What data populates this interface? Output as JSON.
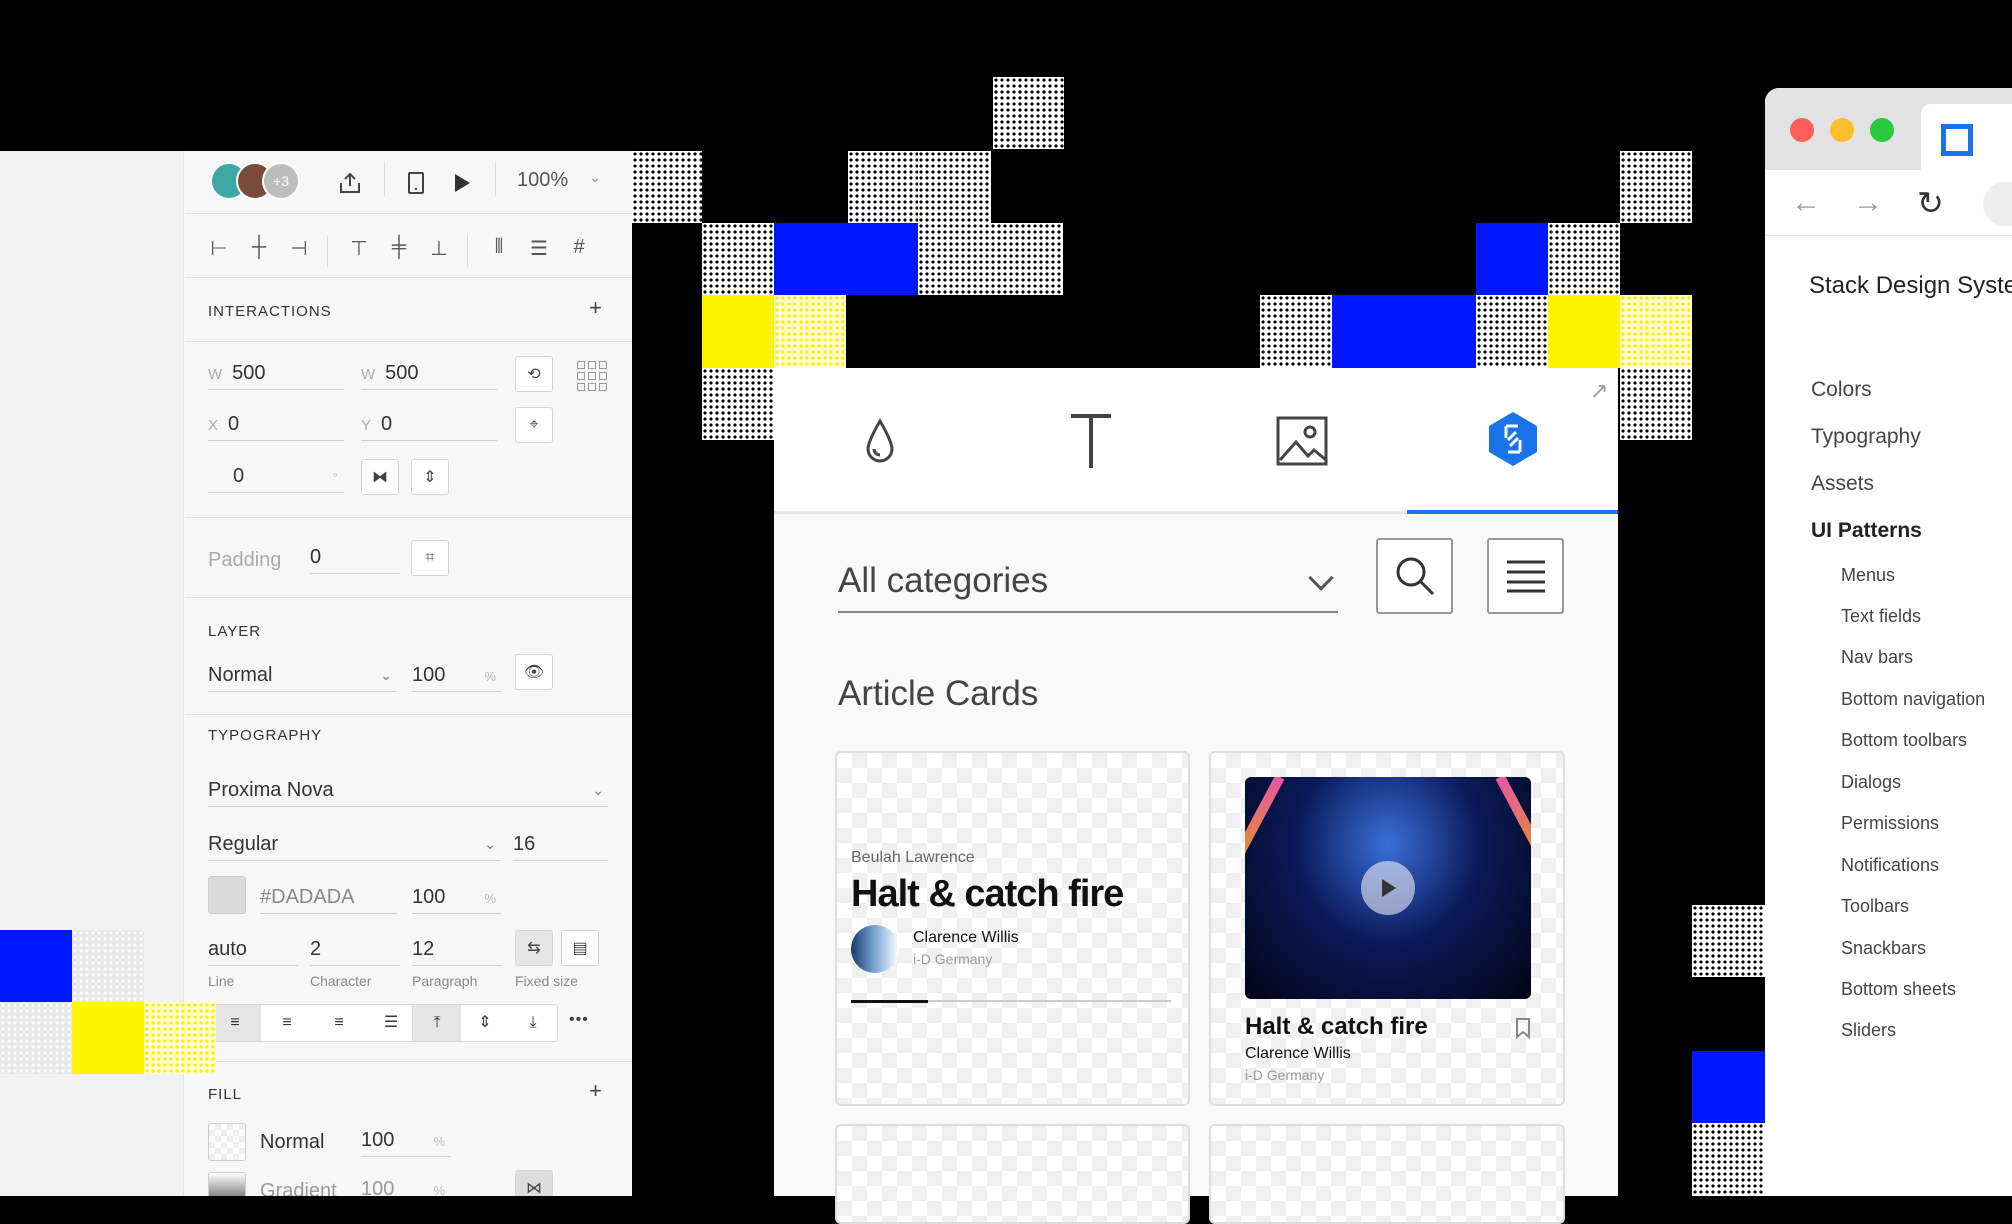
{
  "toolbar": {
    "avatar_extra": "+3",
    "zoom": "100%"
  },
  "interactions": {
    "label": "INTERACTIONS",
    "add": "+"
  },
  "geometry": {
    "w_label": "W",
    "w_value": "500",
    "h_label": "W",
    "h_value": "500",
    "x_label": "X",
    "x_value": "0",
    "y_label": "Y",
    "y_value": "0",
    "rotation_value": "0",
    "rotation_unit": "°"
  },
  "padding": {
    "label": "Padding",
    "value": "0"
  },
  "layer": {
    "label": "LAYER",
    "blend": "Normal",
    "opacity": "100",
    "unit": "%"
  },
  "typography": {
    "label": "TYPOGRAPHY",
    "font": "Proxima Nova",
    "weight": "Regular",
    "size": "16",
    "color": "#DADADA",
    "color_opacity": "100",
    "unit": "%",
    "line_value": "auto",
    "line_label": "Line",
    "character_value": "2",
    "character_label": "Character",
    "paragraph_value": "12",
    "paragraph_label": "Paragraph",
    "fixed_label": "Fixed size",
    "more": "•••"
  },
  "fill": {
    "label": "FILL",
    "add": "+",
    "row1_type": "Normal",
    "row1_opacity": "100",
    "row2_type": "Gradient",
    "row2_opacity": "100",
    "unit": "%"
  },
  "card": {
    "expand": "↗",
    "category": "All categories",
    "section_title": "Article Cards",
    "tile1": {
      "author": "Beulah Lawrence",
      "title": "Halt & catch fire",
      "name": "Clarence Willis",
      "source": "i-D Germany"
    },
    "tile2": {
      "title": "Halt & catch fire",
      "name": "Clarence Willis",
      "source": "i-D Germany"
    }
  },
  "browser": {
    "title": "Stack Design Syste",
    "nav": [
      "Colors",
      "Typography",
      "Assets",
      "UI Patterns"
    ],
    "sub": [
      "Menus",
      "Text fields",
      "Nav bars",
      "Bottom navigation",
      "Bottom toolbars",
      "Dialogs",
      "Permissions",
      "Notifications",
      "Toolbars",
      "Snackbars",
      "Bottom sheets",
      "Sliders"
    ]
  },
  "colors": {
    "accent": "#1a73e8",
    "pixel_blue": "#0018ff",
    "pixel_yellow": "#fff500"
  }
}
